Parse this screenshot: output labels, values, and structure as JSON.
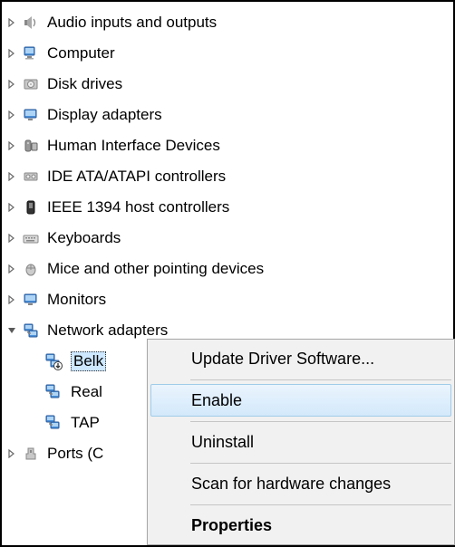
{
  "tree": {
    "items": [
      {
        "label": "Audio inputs and outputs",
        "icon": "speaker"
      },
      {
        "label": "Computer",
        "icon": "computer"
      },
      {
        "label": "Disk drives",
        "icon": "disk"
      },
      {
        "label": "Display adapters",
        "icon": "display"
      },
      {
        "label": "Human Interface Devices",
        "icon": "hid"
      },
      {
        "label": "IDE ATA/ATAPI controllers",
        "icon": "ide"
      },
      {
        "label": "IEEE 1394 host controllers",
        "icon": "firewire"
      },
      {
        "label": "Keyboards",
        "icon": "keyboard"
      },
      {
        "label": "Mice and other pointing devices",
        "icon": "mouse"
      },
      {
        "label": "Monitors",
        "icon": "monitor"
      },
      {
        "label": "Network adapters",
        "icon": "network",
        "expanded": true
      },
      {
        "label": "Ports (C",
        "icon": "port"
      }
    ],
    "network_children": [
      {
        "label": "Belk",
        "icon": "netdown",
        "selected": true
      },
      {
        "label": "Real",
        "icon": "net"
      },
      {
        "label": "TAP",
        "icon": "net"
      }
    ]
  },
  "context_menu": {
    "items": [
      {
        "label": "Update Driver Software...",
        "type": "item"
      },
      {
        "type": "sep"
      },
      {
        "label": "Enable",
        "type": "item",
        "highlight": true
      },
      {
        "type": "sep"
      },
      {
        "label": "Uninstall",
        "type": "item"
      },
      {
        "type": "sep"
      },
      {
        "label": "Scan for hardware changes",
        "type": "item"
      },
      {
        "type": "sep"
      },
      {
        "label": "Properties",
        "type": "item",
        "bold": true
      }
    ]
  }
}
